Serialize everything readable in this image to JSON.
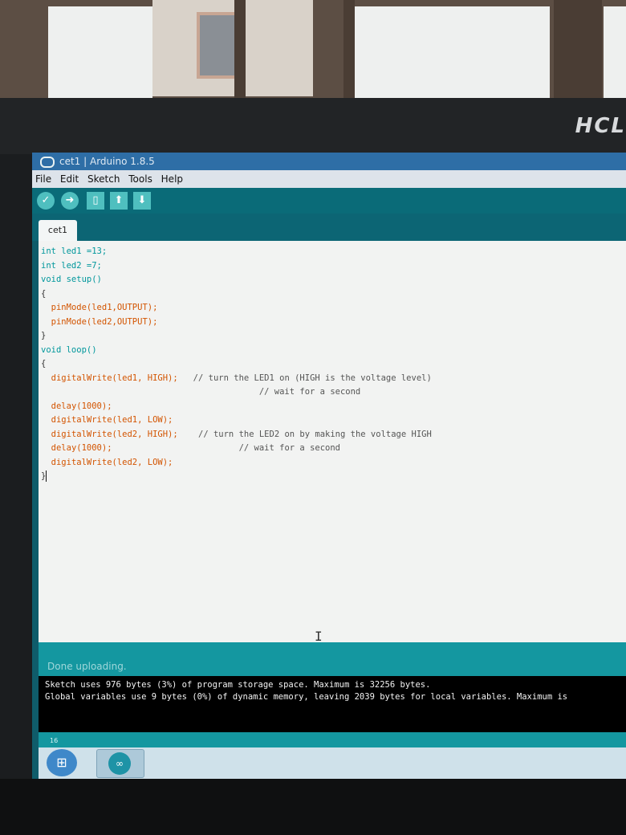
{
  "monitor": {
    "brand": "HCL"
  },
  "window": {
    "title": "cet1 | Arduino 1.8.5"
  },
  "menu": [
    "File",
    "Edit",
    "Sketch",
    "Tools",
    "Help"
  ],
  "toolbar": {
    "verify_icon": "checkmark-icon",
    "upload_icon": "arrow-right-icon",
    "new_icon": "new-file-icon",
    "open_icon": "arrow-up-icon",
    "save_icon": "arrow-down-icon"
  },
  "tab": {
    "label": "cet1"
  },
  "code_lines": [
    "int led1 =13;",
    "int led2 =7;",
    "void setup()",
    "{",
    "pinMode(led1,OUTPUT);",
    "pinMode(led2,OUTPUT);",
    "}",
    "void loop()",
    "{",
    "digitalWrite(led1, HIGH);",
    "// turn the LED1 on (HIGH is the voltage level)",
    "// wait for a second",
    "delay(1000);",
    "digitalWrite(led1, LOW);",
    "digitalWrite(led2, HIGH);",
    "// turn the LED2 on by making the voltage HIGH",
    "delay(1000);",
    "// wait for a second",
    "digitalWrite(led2, LOW);",
    "}"
  ],
  "status": {
    "message": "Done uploading."
  },
  "console": {
    "line1": "Sketch uses 976 bytes (3%) of program storage space. Maximum is 32256 bytes.",
    "line2": "Global variables use 9 bytes (0%) of dynamic memory, leaving 2039 bytes for local variables. Maximum is"
  },
  "line_number": "16",
  "colors": {
    "teal": "#00979c",
    "toolbar_bg": "#0a6b78",
    "status_bar": "#1497a0",
    "titlebar": "#2e6ea6"
  }
}
